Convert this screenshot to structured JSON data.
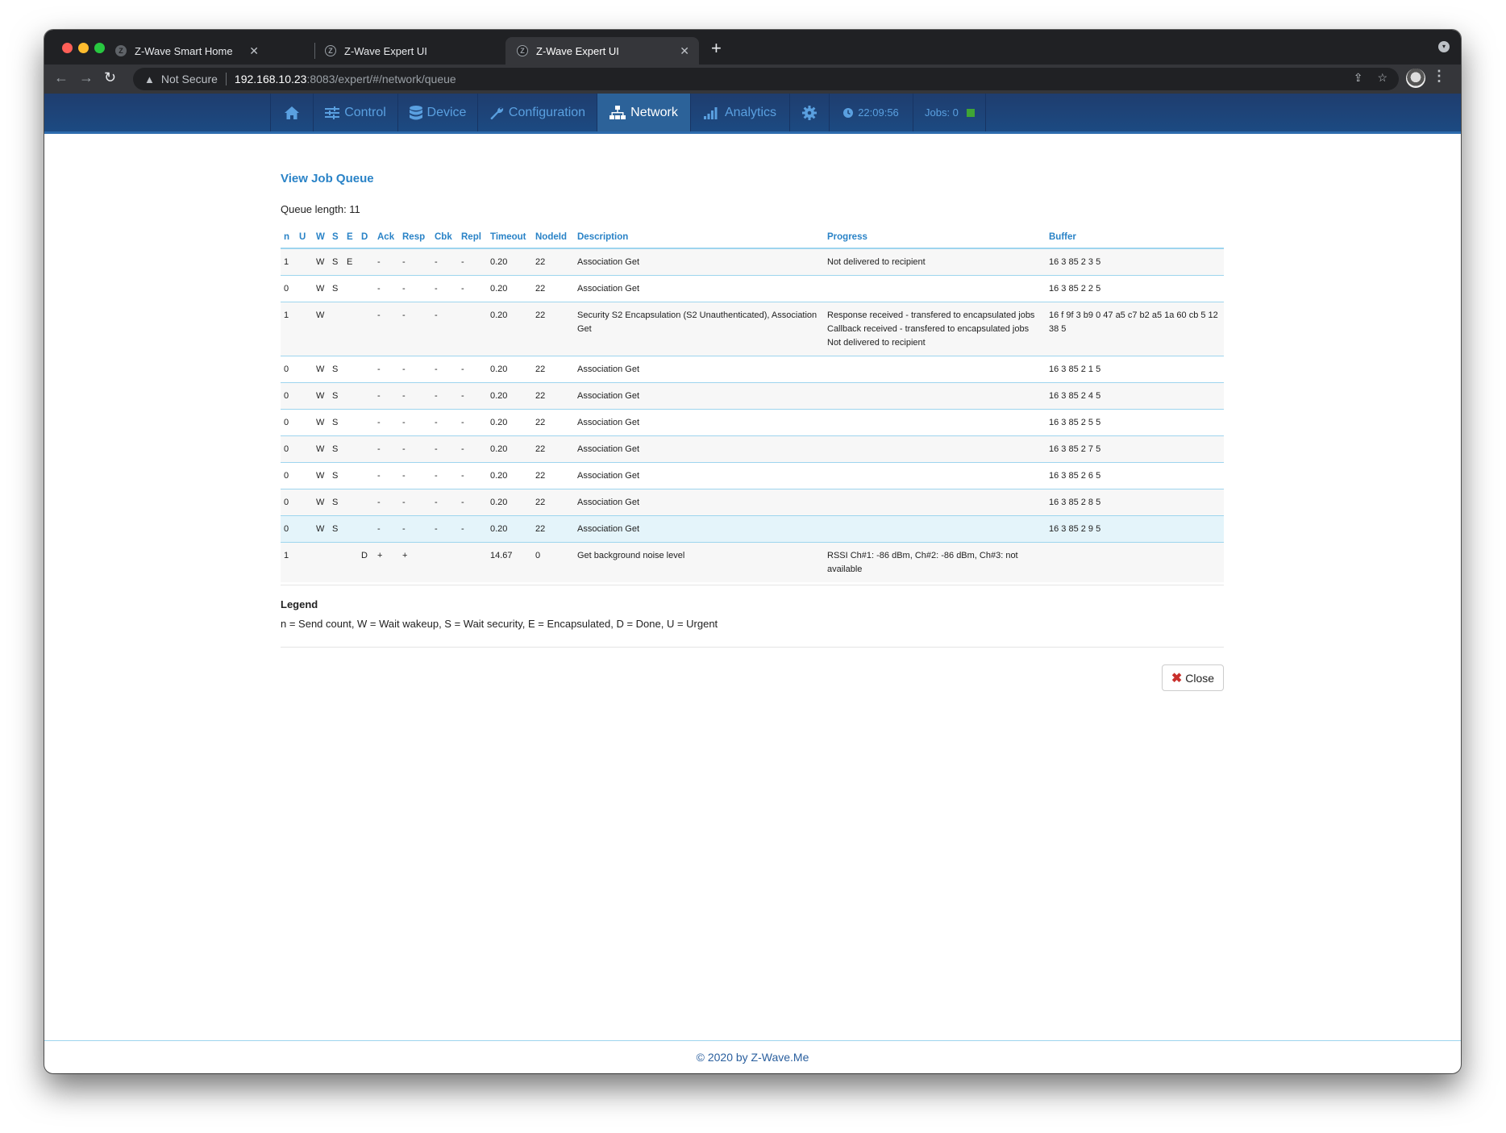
{
  "browser": {
    "tabs": [
      {
        "title": "Z-Wave Smart Home",
        "active": false
      },
      {
        "title": "Z-Wave Expert UI",
        "active": false
      },
      {
        "title": "Z-Wave Expert UI",
        "active": true
      }
    ],
    "security_label": "Not Secure",
    "url_host": "192.168.10.23",
    "url_path": ":8083/expert/#/network/queue"
  },
  "nav": {
    "items": [
      {
        "label": "",
        "icon": "home-icon"
      },
      {
        "label": "Control",
        "icon": "sliders-icon"
      },
      {
        "label": "Device",
        "icon": "database-icon"
      },
      {
        "label": "Configuration",
        "icon": "wrench-icon"
      },
      {
        "label": "Network",
        "icon": "sitemap-icon",
        "active": true
      },
      {
        "label": "Analytics",
        "icon": "signal-bars-icon"
      },
      {
        "label": "",
        "icon": "gear-icon"
      }
    ],
    "clock": "22:09:56",
    "jobs_label": "Jobs: 0",
    "jobs_status_color": "#3fa535"
  },
  "page": {
    "title": "View Job Queue",
    "queue_length_label": "Queue length: 11"
  },
  "table": {
    "columns": [
      "n",
      "U",
      "W",
      "S",
      "E",
      "D",
      "Ack",
      "Resp",
      "Cbk",
      "Repl",
      "Timeout",
      "NodeId",
      "Description",
      "Progress",
      "Buffer"
    ],
    "rows": [
      {
        "n": "1",
        "U": "",
        "W": "W",
        "S": "S",
        "E": "E",
        "D": "",
        "Ack": "-",
        "Resp": "-",
        "Cbk": "-",
        "Repl": "-",
        "Timeout": "0.20",
        "NodeId": "22",
        "Description": "Association Get",
        "Progress": [
          "Not delivered to recipient"
        ],
        "Buffer": "16 3 85 2 3 5"
      },
      {
        "n": "0",
        "U": "",
        "W": "W",
        "S": "S",
        "E": "",
        "D": "",
        "Ack": "-",
        "Resp": "-",
        "Cbk": "-",
        "Repl": "-",
        "Timeout": "0.20",
        "NodeId": "22",
        "Description": "Association Get",
        "Progress": [],
        "Buffer": "16 3 85 2 2 5"
      },
      {
        "n": "1",
        "U": "",
        "W": "W",
        "S": "",
        "E": "",
        "D": "",
        "Ack": "-",
        "Resp": "-",
        "Cbk": "-",
        "Repl": "",
        "Timeout": "0.20",
        "NodeId": "22",
        "Description": "Security S2 Encapsulation (S2 Unauthenticated), Association Get",
        "Progress": [
          "Response received - transfered to encapsulated jobs",
          "Callback received - transfered to encapsulated jobs",
          "Not delivered to recipient"
        ],
        "Buffer": "16 f 9f 3 b9 0 47 a5 c7 b2 a5 1a 60 cb 5 12 38 5"
      },
      {
        "n": "0",
        "U": "",
        "W": "W",
        "S": "S",
        "E": "",
        "D": "",
        "Ack": "-",
        "Resp": "-",
        "Cbk": "-",
        "Repl": "-",
        "Timeout": "0.20",
        "NodeId": "22",
        "Description": "Association Get",
        "Progress": [],
        "Buffer": "16 3 85 2 1 5"
      },
      {
        "n": "0",
        "U": "",
        "W": "W",
        "S": "S",
        "E": "",
        "D": "",
        "Ack": "-",
        "Resp": "-",
        "Cbk": "-",
        "Repl": "-",
        "Timeout": "0.20",
        "NodeId": "22",
        "Description": "Association Get",
        "Progress": [],
        "Buffer": "16 3 85 2 4 5"
      },
      {
        "n": "0",
        "U": "",
        "W": "W",
        "S": "S",
        "E": "",
        "D": "",
        "Ack": "-",
        "Resp": "-",
        "Cbk": "-",
        "Repl": "-",
        "Timeout": "0.20",
        "NodeId": "22",
        "Description": "Association Get",
        "Progress": [],
        "Buffer": "16 3 85 2 5 5"
      },
      {
        "n": "0",
        "U": "",
        "W": "W",
        "S": "S",
        "E": "",
        "D": "",
        "Ack": "-",
        "Resp": "-",
        "Cbk": "-",
        "Repl": "-",
        "Timeout": "0.20",
        "NodeId": "22",
        "Description": "Association Get",
        "Progress": [],
        "Buffer": "16 3 85 2 7 5"
      },
      {
        "n": "0",
        "U": "",
        "W": "W",
        "S": "S",
        "E": "",
        "D": "",
        "Ack": "-",
        "Resp": "-",
        "Cbk": "-",
        "Repl": "-",
        "Timeout": "0.20",
        "NodeId": "22",
        "Description": "Association Get",
        "Progress": [],
        "Buffer": "16 3 85 2 6 5"
      },
      {
        "n": "0",
        "U": "",
        "W": "W",
        "S": "S",
        "E": "",
        "D": "",
        "Ack": "-",
        "Resp": "-",
        "Cbk": "-",
        "Repl": "-",
        "Timeout": "0.20",
        "NodeId": "22",
        "Description": "Association Get",
        "Progress": [],
        "Buffer": "16 3 85 2 8 5"
      },
      {
        "n": "0",
        "U": "",
        "W": "W",
        "S": "S",
        "E": "",
        "D": "",
        "Ack": "-",
        "Resp": "-",
        "Cbk": "-",
        "Repl": "-",
        "Timeout": "0.20",
        "NodeId": "22",
        "Description": "Association Get",
        "Progress": [],
        "Buffer": "16 3 85 2 9 5",
        "hover": true
      },
      {
        "n": "1",
        "U": "",
        "W": "",
        "S": "",
        "E": "",
        "D": "D",
        "Ack": "+",
        "Resp": "+",
        "Cbk": "",
        "Repl": "",
        "Timeout": "14.67",
        "NodeId": "0",
        "Description": "Get background noise level",
        "Progress": [
          "RSSI Ch#1: -86 dBm, Ch#2: -86 dBm, Ch#3: not available"
        ],
        "Buffer": ""
      }
    ]
  },
  "legend": {
    "title": "Legend",
    "text": "n = Send count, W = Wait wakeup, S = Wait security, E = Encapsulated, D = Done, U = Urgent"
  },
  "close_label": "Close",
  "footer": "© 2020 by Z-Wave.Me"
}
